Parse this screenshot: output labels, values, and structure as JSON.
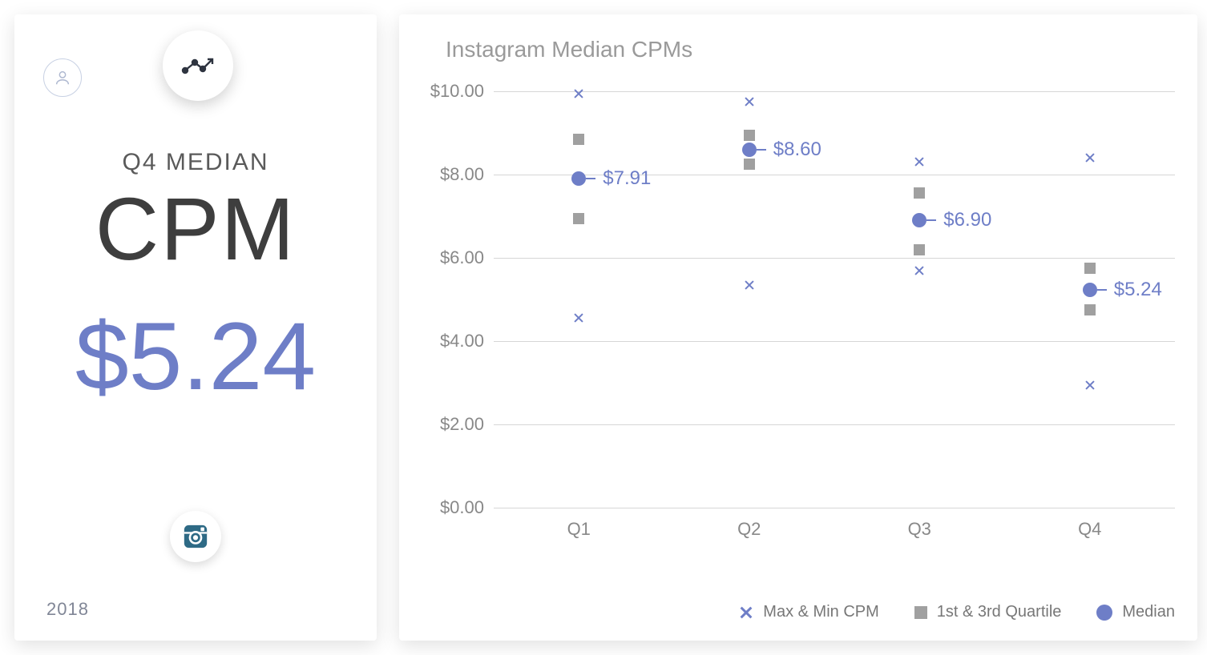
{
  "summary": {
    "label": "Q4 MEDIAN",
    "metric": "CPM",
    "value": "$5.24",
    "year": "2018"
  },
  "chart": {
    "title": "Instagram Median CPMs"
  },
  "legend": {
    "maxmin": "Max & Min CPM",
    "quartile": "1st & 3rd Quartile",
    "median": "Median"
  },
  "chart_data": {
    "type": "scatter",
    "title": "Instagram Median CPMs",
    "xlabel": "",
    "ylabel": "",
    "ylim": [
      0,
      10
    ],
    "yticks": [
      "$0.00",
      "$2.00",
      "$4.00",
      "$6.00",
      "$8.00",
      "$10.00"
    ],
    "ytick_values": [
      0,
      2,
      4,
      6,
      8,
      10
    ],
    "categories": [
      "Q1",
      "Q2",
      "Q3",
      "Q4"
    ],
    "series": [
      {
        "name": "Max & Min CPM",
        "role": "maxmin",
        "max": [
          9.95,
          9.75,
          8.3,
          8.4
        ],
        "min": [
          4.55,
          5.35,
          5.7,
          2.95
        ]
      },
      {
        "name": "1st & 3rd Quartile",
        "role": "quartile",
        "q3": [
          8.85,
          8.95,
          7.55,
          5.75
        ],
        "q1": [
          6.95,
          8.25,
          6.2,
          4.75
        ]
      },
      {
        "name": "Median",
        "role": "median",
        "values": [
          7.91,
          8.6,
          6.9,
          5.24
        ],
        "labels": [
          "$7.91",
          "$8.60",
          "$6.90",
          "$5.24"
        ]
      }
    ]
  }
}
